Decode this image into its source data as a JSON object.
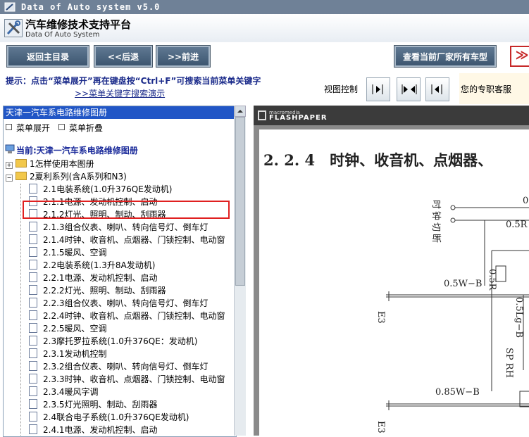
{
  "window": {
    "title": "Data of Auto system v5.0"
  },
  "header": {
    "title": "汽车维修技术支持平台",
    "subtitle": "Data Of Auto System"
  },
  "toolbar": {
    "home_label": "返回主目录",
    "back_label": "<<后退",
    "forward_label": ">>前进",
    "models_label": "查看当前厂家所有车型",
    "more_label": "≫"
  },
  "hint": {
    "text": "提示：点击“菜单展开”再在键盘按“Ctrl+F”可搜索当前菜单关键字",
    "link": ">>菜单关键字搜索演示"
  },
  "view_control": {
    "label": "视图控制"
  },
  "service": {
    "label": "您的专职客服"
  },
  "left_panel": {
    "title": "天津一汽车系电路维修图册",
    "expand_label": "菜单展开",
    "collapse_label": "菜单折叠",
    "current_label": "当前:天津一汽车系电路维修图册",
    "tree": [
      {
        "label": "1怎样使用本图册",
        "level": 0,
        "type": "folder",
        "toggle": "+"
      },
      {
        "label": "2夏利系列(含A系列和N3)",
        "level": 0,
        "type": "folder",
        "toggle": "−"
      },
      {
        "label": "2.1电装系统(1.0升376QE发动机)",
        "level": 1,
        "type": "doc"
      },
      {
        "label": "2.1.1电源、发动机控制、启动",
        "level": 1,
        "type": "doc"
      },
      {
        "label": "2.1.2灯光、照明、制动、刮雨器",
        "level": 1,
        "type": "doc"
      },
      {
        "label": "2.1.3组合仪表、喇叭、转向信号灯、倒车灯",
        "level": 1,
        "type": "doc"
      },
      {
        "label": "2.1.4时钟、收音机、点烟器、门锁控制、电动窗",
        "level": 1,
        "type": "doc"
      },
      {
        "label": "2.1.5暖风、空调",
        "level": 1,
        "type": "doc"
      },
      {
        "label": "2.2电装系统(1.3升8A发动机)",
        "level": 1,
        "type": "doc"
      },
      {
        "label": "2.2.1电源、发动机控制、启动",
        "level": 1,
        "type": "doc"
      },
      {
        "label": "2.2.2灯光、照明、制动、刮雨器",
        "level": 1,
        "type": "doc"
      },
      {
        "label": "2.2.3组合仪表、喇叭、转向信号灯、倒车灯",
        "level": 1,
        "type": "doc"
      },
      {
        "label": "2.2.4时钟、收音机、点烟器、门锁控制、电动窗",
        "level": 1,
        "type": "doc",
        "selected": true
      },
      {
        "label": "2.2.5暖风、空调",
        "level": 1,
        "type": "doc"
      },
      {
        "label": "2.3摩托罗拉系统(1.0升376QE：发动机)",
        "level": 1,
        "type": "doc"
      },
      {
        "label": "2.3.1发动机控制",
        "level": 1,
        "type": "doc"
      },
      {
        "label": "2.3.2组合仪表、喇叭、转向信号灯、倒车灯",
        "level": 1,
        "type": "doc"
      },
      {
        "label": "2.3.3时钟、收音机、点烟器、门锁控制、电动窗",
        "level": 1,
        "type": "doc"
      },
      {
        "label": "2.3.4暖风字调",
        "level": 1,
        "type": "doc"
      },
      {
        "label": "2.3.5灯光照明、制动、刮雨器",
        "level": 1,
        "type": "doc"
      },
      {
        "label": "2.4联合电子系统(1.0升376QE发动机)",
        "level": 1,
        "type": "doc"
      },
      {
        "label": "2.4.1电源、发动机控制、启动",
        "level": 1,
        "type": "doc"
      }
    ]
  },
  "viewer": {
    "brand_top": "macromedia",
    "brand_bottom": "FLASHPAPER",
    "section_title": "2. 2. 4　时钟、收音机、点烟器、",
    "diagram_labels": {
      "switch": "时钟切断",
      "w1": "0.5R",
      "w2": "0.5R",
      "w3": "0.5W−B",
      "w4": "0.5Lg−B",
      "w5": "SP RH",
      "w6": "0.85W−B",
      "e1": "E3",
      "e2": "E3",
      "partial": "0"
    }
  }
}
